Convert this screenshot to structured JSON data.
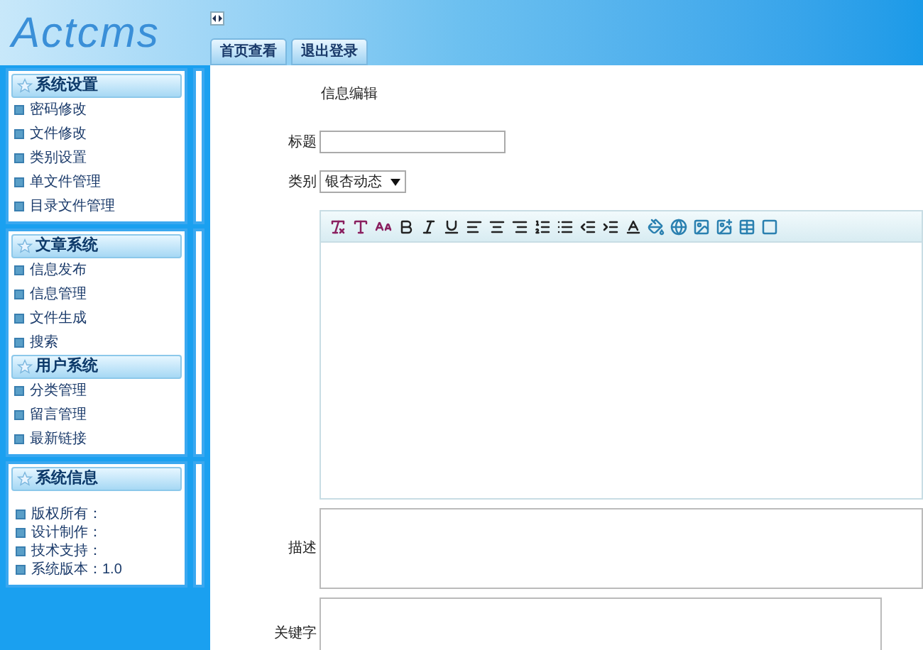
{
  "header": {
    "logo": "Actcms",
    "tabs": [
      {
        "label": "首页查看"
      },
      {
        "label": "退出登录"
      }
    ]
  },
  "sidebar": {
    "panels": [
      {
        "kind": "menu",
        "groups": [
          {
            "title": "系统设置",
            "items": [
              "密码修改",
              "文件修改",
              "类别设置",
              "单文件管理",
              "目录文件管理"
            ]
          }
        ]
      },
      {
        "kind": "menu",
        "groups": [
          {
            "title": "文章系统",
            "items": [
              "信息发布",
              "信息管理",
              "文件生成",
              "搜索"
            ]
          },
          {
            "title": "用户系统",
            "items": [
              "分类管理",
              "留言管理",
              "最新链接"
            ]
          }
        ]
      },
      {
        "kind": "info",
        "groups": [
          {
            "title": "系统信息",
            "items": [
              "版权所有：",
              "设计制作：",
              "技术支持：",
              "系统版本：1.0"
            ]
          }
        ]
      }
    ]
  },
  "form": {
    "heading": "信息编辑",
    "fields": [
      {
        "kind": "input",
        "label": "标题"
      },
      {
        "kind": "select",
        "label": "类别",
        "value": "银杏动态"
      },
      {
        "kind": "editor"
      },
      {
        "kind": "textarea",
        "label": "描述"
      },
      {
        "kind": "textarea-short",
        "label": "关键字"
      }
    ]
  }
}
